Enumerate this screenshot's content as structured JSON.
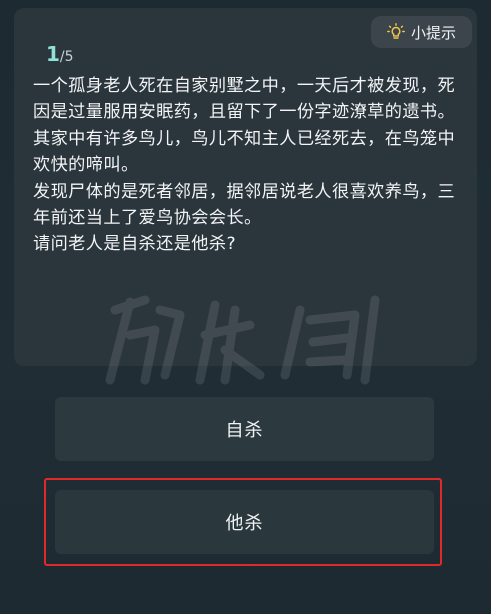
{
  "progress": {
    "current": "1",
    "separator": "/",
    "total": "5"
  },
  "hint": {
    "label": "小提示",
    "icon": "lightbulb-icon"
  },
  "question": {
    "text": "一个孤身老人死在自家别墅之中，一天后才被发现，死因是过量服用安眠药，且留下了一份字迹潦草的遗书。其家中有许多鸟儿，鸟儿不知主人已经死去，在鸟笼中欢快的啼叫。\n发现尸体的是死者邻居，据邻居说老人很喜欢养鸟，三年前还当上了爱鸟协会会长。\n请问老人是自杀还是他杀?"
  },
  "options": [
    {
      "label": "自杀"
    },
    {
      "label": "他杀"
    }
  ],
  "colors": {
    "background": "#1f2b33",
    "card": "#2a353c",
    "accent": "#8fe3d6",
    "highlight": "#e02a2a"
  }
}
